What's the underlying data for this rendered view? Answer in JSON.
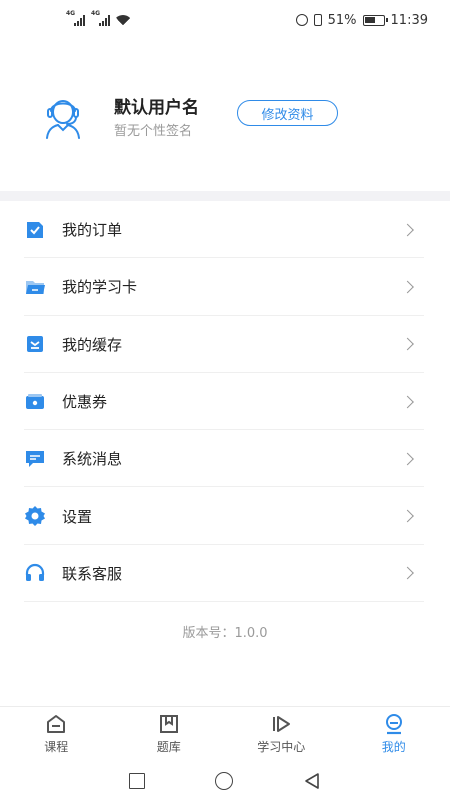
{
  "status_bar": {
    "network1": "4G",
    "network2": "4G",
    "battery": "51%",
    "time": "11:39"
  },
  "profile": {
    "username": "默认用户名",
    "signature": "暂无个性签名",
    "edit_button": "修改资料",
    "accent": "#2f8be8"
  },
  "menu": {
    "items": [
      {
        "label": "我的订单",
        "icon": "order-icon"
      },
      {
        "label": "我的学习卡",
        "icon": "folder-icon"
      },
      {
        "label": "我的缓存",
        "icon": "download-icon"
      },
      {
        "label": "优惠券",
        "icon": "coupon-icon"
      },
      {
        "label": "系统消息",
        "icon": "message-icon"
      },
      {
        "label": "设置",
        "icon": "gear-icon"
      },
      {
        "label": "联系客服",
        "icon": "headset-icon"
      }
    ]
  },
  "version": "版本号：1.0.0",
  "tabbar": {
    "tabs": [
      {
        "label": "课程",
        "icon": "course-icon",
        "active": false
      },
      {
        "label": "题库",
        "icon": "question-bank-icon",
        "active": false
      },
      {
        "label": "学习中心",
        "icon": "play-icon",
        "active": false
      },
      {
        "label": "我的",
        "icon": "profile-icon",
        "active": true
      }
    ]
  }
}
